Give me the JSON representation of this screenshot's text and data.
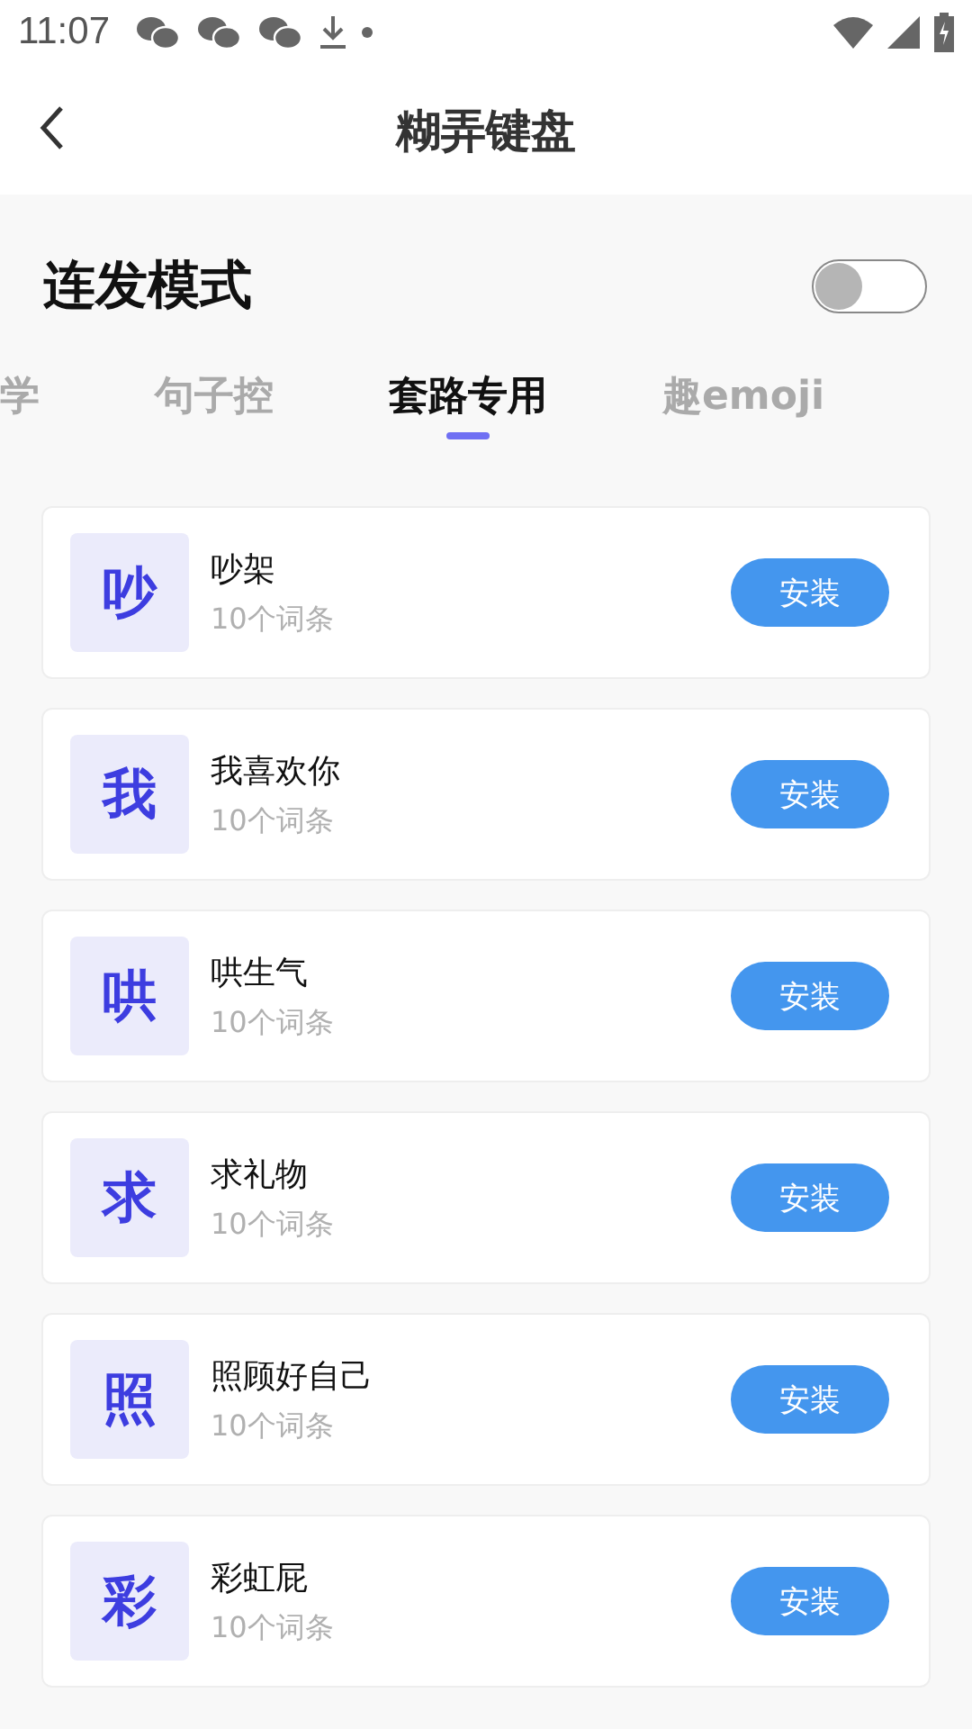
{
  "status_bar": {
    "time": "11:07"
  },
  "header": {
    "title": "糊弄键盘"
  },
  "burst_mode": {
    "label": "连发模式",
    "on": false
  },
  "tabs": [
    {
      "label": "学",
      "selected": false
    },
    {
      "label": "句子控",
      "selected": false
    },
    {
      "label": "套路专用",
      "selected": true
    },
    {
      "label": "趣emoji",
      "selected": false
    }
  ],
  "packs": [
    {
      "glyph": "吵",
      "name": "吵架",
      "count": "10个词条",
      "action": "安装"
    },
    {
      "glyph": "我",
      "name": "我喜欢你",
      "count": "10个词条",
      "action": "安装"
    },
    {
      "glyph": "哄",
      "name": "哄生气",
      "count": "10个词条",
      "action": "安装"
    },
    {
      "glyph": "求",
      "name": "求礼物",
      "count": "10个词条",
      "action": "安装"
    },
    {
      "glyph": "照",
      "name": "照顾好自己",
      "count": "10个词条",
      "action": "安装"
    },
    {
      "glyph": "彩",
      "name": "彩虹屁",
      "count": "10个词条",
      "action": "安装"
    }
  ]
}
